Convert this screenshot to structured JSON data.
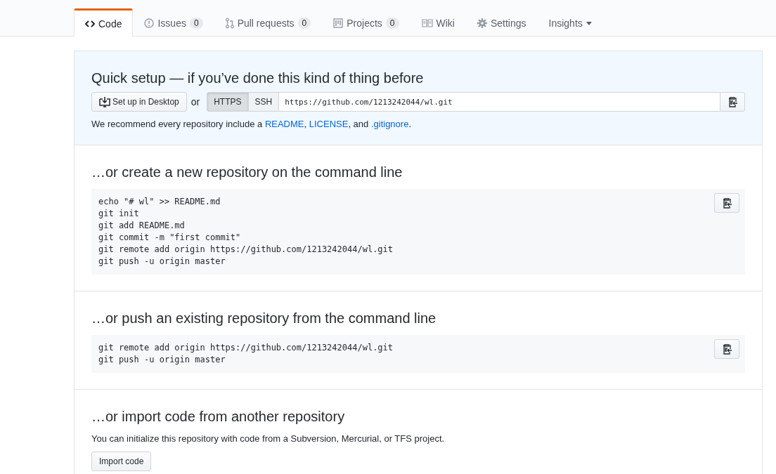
{
  "tabs": [
    {
      "kind": "code",
      "label": "Code",
      "selected": true
    },
    {
      "kind": "issue",
      "label": "Issues",
      "count": "0",
      "selected": false
    },
    {
      "kind": "pull",
      "label": "Pull requests",
      "count": "0",
      "selected": false
    },
    {
      "kind": "project",
      "label": "Projects",
      "count": "0",
      "selected": false
    },
    {
      "kind": "book",
      "label": "Wiki",
      "selected": false
    },
    {
      "kind": "gear",
      "label": "Settings",
      "selected": false
    },
    {
      "kind": "dropdown",
      "label": "Insights",
      "selected": false
    }
  ],
  "quick_setup": {
    "title": "Quick setup — if you’ve done this kind of thing before",
    "desktop_button": "Set up in Desktop",
    "or": "or",
    "protocols": [
      {
        "label": "HTTPS",
        "selected": true
      },
      {
        "label": "SSH",
        "selected": false
      }
    ],
    "url": "https://github.com/1213242044/wl.git",
    "recommend": [
      {
        "text": "We recommend every repository include a "
      },
      {
        "text": "README",
        "link": true
      },
      {
        "text": ", "
      },
      {
        "text": "LICENSE",
        "link": true
      },
      {
        "text": ", and "
      },
      {
        "text": ".gitignore",
        "link": true
      },
      {
        "text": "."
      }
    ]
  },
  "sections": [
    {
      "title": "…or create a new repository on the command line",
      "code": [
        "echo \"# wl\" >> README.md",
        "git init",
        "git add README.md",
        "git commit -m \"first commit\"",
        "git remote add origin https://github.com/1213242044/wl.git",
        "git push -u origin master"
      ]
    },
    {
      "title": "…or push an existing repository from the command line",
      "code": [
        "git remote add origin https://github.com/1213242044/wl.git",
        "git push -u origin master"
      ]
    }
  ],
  "import": {
    "title": "…or import code from another repository",
    "text": "You can initialize this repository with code from a Subversion, Mercurial, or TFS project.",
    "button": "Import code"
  }
}
